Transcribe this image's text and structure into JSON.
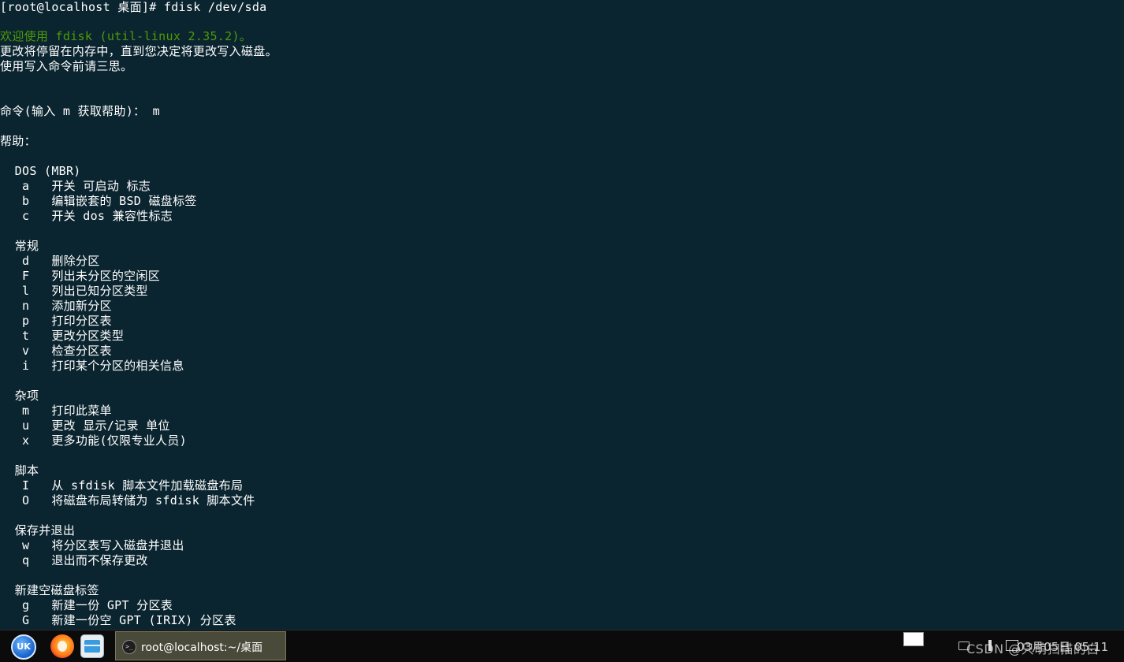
{
  "terminal": {
    "lines": [
      "[root@localhost 桌面]# fdisk /dev/sda",
      "",
      "欢迎使用 fdisk (util-linux 2.35.2)。",
      "更改将停留在内存中，直到您决定将更改写入磁盘。",
      "使用写入命令前请三思。",
      "",
      "",
      "命令(输入 m 获取帮助)： m",
      "",
      "帮助：",
      "",
      "  DOS (MBR)",
      "   a   开关 可启动 标志",
      "   b   编辑嵌套的 BSD 磁盘标签",
      "   c   开关 dos 兼容性标志",
      "",
      "  常规",
      "   d   删除分区",
      "   F   列出未分区的空闲区",
      "   l   列出已知分区类型",
      "   n   添加新分区",
      "   p   打印分区表",
      "   t   更改分区类型",
      "   v   检查分区表",
      "   i   打印某个分区的相关信息",
      "",
      "  杂项",
      "   m   打印此菜单",
      "   u   更改 显示/记录 单位",
      "   x   更多功能(仅限专业人员)",
      "",
      "  脚本",
      "   I   从 sfdisk 脚本文件加载磁盘布局",
      "   O   将磁盘布局转储为 sfdisk 脚本文件",
      "",
      "  保存并退出",
      "   w   将分区表写入磁盘并退出",
      "   q   退出而不保存更改",
      "",
      "  新建空磁盘标签",
      "   g   新建一份 GPT 分区表",
      "   G   新建一份空 GPT (IRIX) 分区表"
    ],
    "text_color": "#ffffff",
    "highlight_color": "#4e9a06",
    "background": "#0b2530"
  },
  "taskbar": {
    "start_icon": "uk-logo-icon",
    "start_label": "UK",
    "firefox_icon": "firefox-icon",
    "files_icon": "file-manager-icon",
    "terminal_task_label": "root@localhost:~/桌面",
    "terminal_task_icon_glyph": ">_",
    "clock": "03月05日 05:11",
    "watermark": "CSDN @只萌扫描的白"
  }
}
